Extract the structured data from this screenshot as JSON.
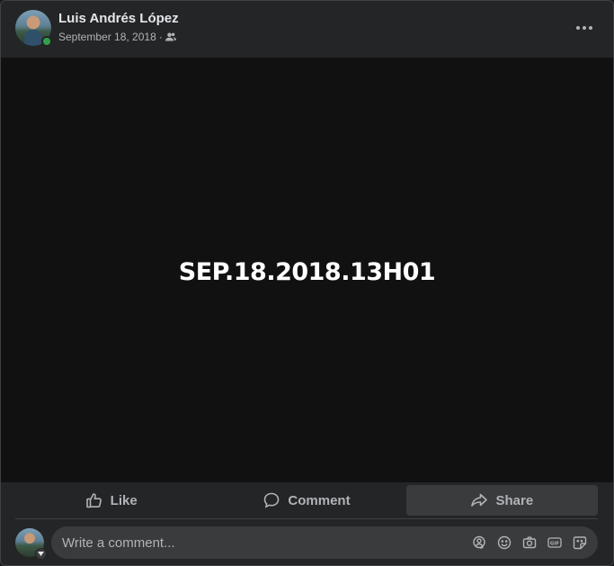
{
  "post": {
    "author": "Luis Andrés López",
    "date": "September 18, 2018",
    "separator": "·",
    "audience_icon": "friends-icon",
    "media_text": "SEP.18.2018.13H01"
  },
  "actions": {
    "like_label": "Like",
    "comment_label": "Comment",
    "share_label": "Share"
  },
  "composer": {
    "placeholder": "Write a comment..."
  },
  "colors": {
    "online": "#31a24c",
    "card_bg": "#242526",
    "media_bg": "#111111"
  }
}
